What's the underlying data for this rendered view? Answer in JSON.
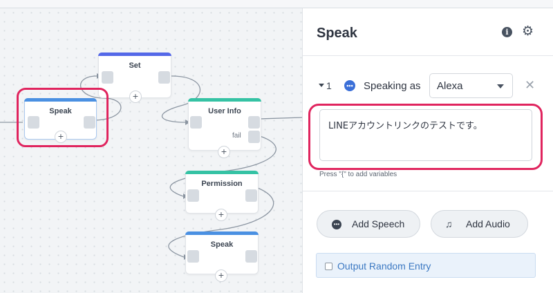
{
  "canvas": {
    "nodes": [
      {
        "id": "speak-main",
        "title": "Speak",
        "accent": "#4a90e2"
      },
      {
        "id": "set",
        "title": "Set",
        "accent": "#5468e8"
      },
      {
        "id": "user-info",
        "title": "User Info",
        "accent": "#35c2a4",
        "fail_label": "fail"
      },
      {
        "id": "permission",
        "title": "Permission",
        "accent": "#35c2a4"
      },
      {
        "id": "speak-bottom",
        "title": "Speak",
        "accent": "#4a90e2"
      }
    ],
    "add_symbol": "+"
  },
  "panel": {
    "title": "Speak",
    "info_icon": "info-icon",
    "settings_icon": "gear-icon",
    "step_number": "1",
    "speaking_as_label": "Speaking as",
    "speaking_as_value": "Alexa",
    "speech_text": "LINEアカウントリンクのテストです。",
    "variables_hint": "Press \"{\" to add variables",
    "add_speech_label": "Add Speech",
    "add_audio_label": "Add Audio",
    "output_random_label": "Output Random Entry"
  },
  "colors": {
    "highlight": "#e0245e",
    "link_blue": "#3b78c2"
  }
}
